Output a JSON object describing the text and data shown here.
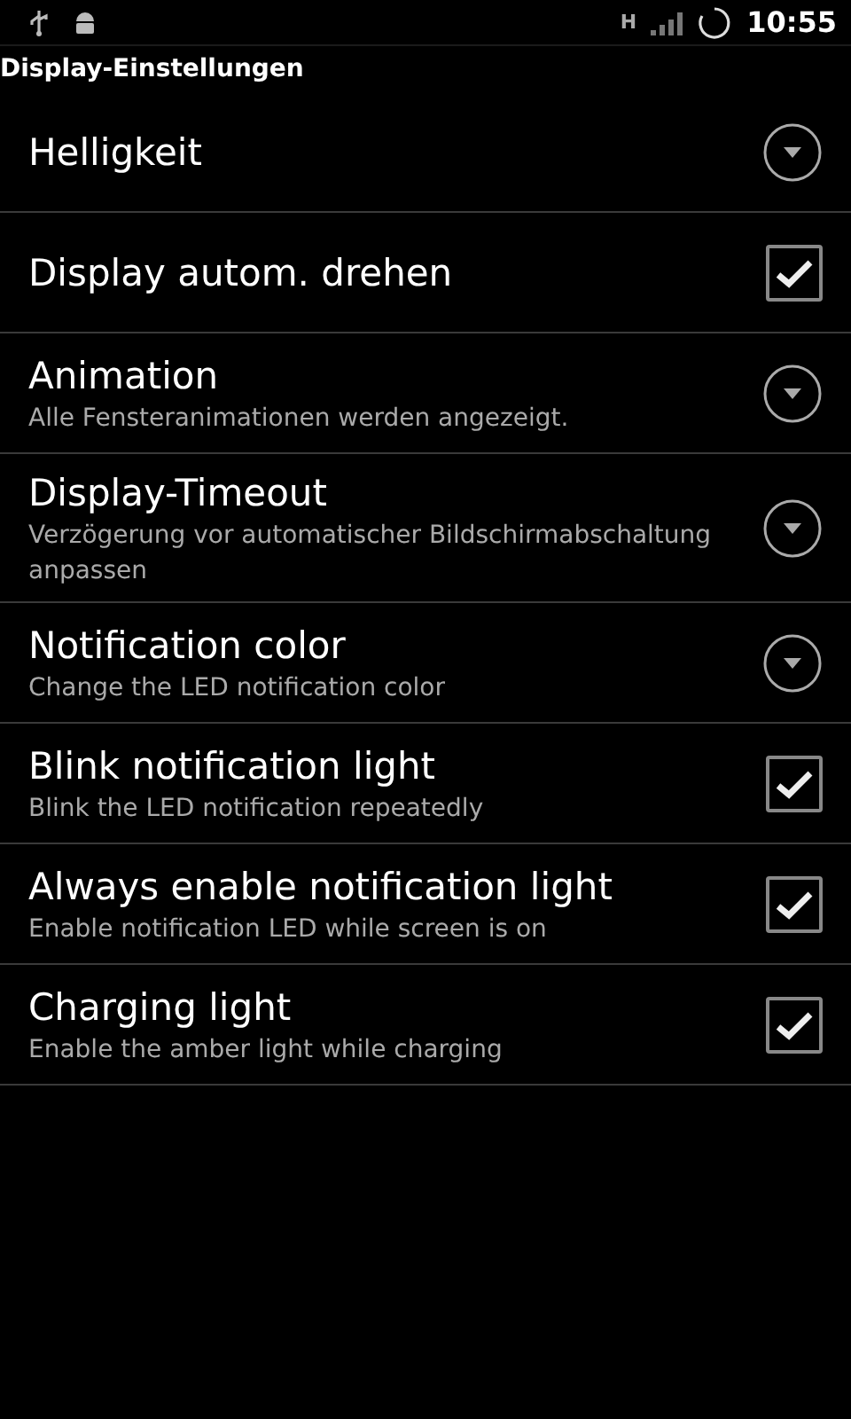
{
  "status_bar": {
    "time": "10:55",
    "network": "H"
  },
  "title": "Display-Einstellungen",
  "settings": [
    {
      "kind": "dropdown",
      "title": "Helligkeit"
    },
    {
      "kind": "checkbox",
      "title": "Display autom. drehen",
      "checked": true
    },
    {
      "kind": "dropdown",
      "title": "Animation",
      "summary": "Alle Fensteranimationen werden angezeigt."
    },
    {
      "kind": "dropdown",
      "title": "Display-Timeout",
      "summary": "Verzögerung vor automatischer Bildschirmabschaltung anpassen"
    },
    {
      "kind": "dropdown",
      "title": "Notification color",
      "summary": "Change the LED notification color"
    },
    {
      "kind": "checkbox",
      "title": "Blink notification light",
      "summary": "Blink the LED notification repeatedly",
      "checked": true
    },
    {
      "kind": "checkbox",
      "title": "Always enable notification light",
      "summary": "Enable notification LED while screen is on",
      "checked": true
    },
    {
      "kind": "checkbox",
      "title": "Charging light",
      "summary": "Enable the amber light while charging",
      "checked": true
    }
  ]
}
